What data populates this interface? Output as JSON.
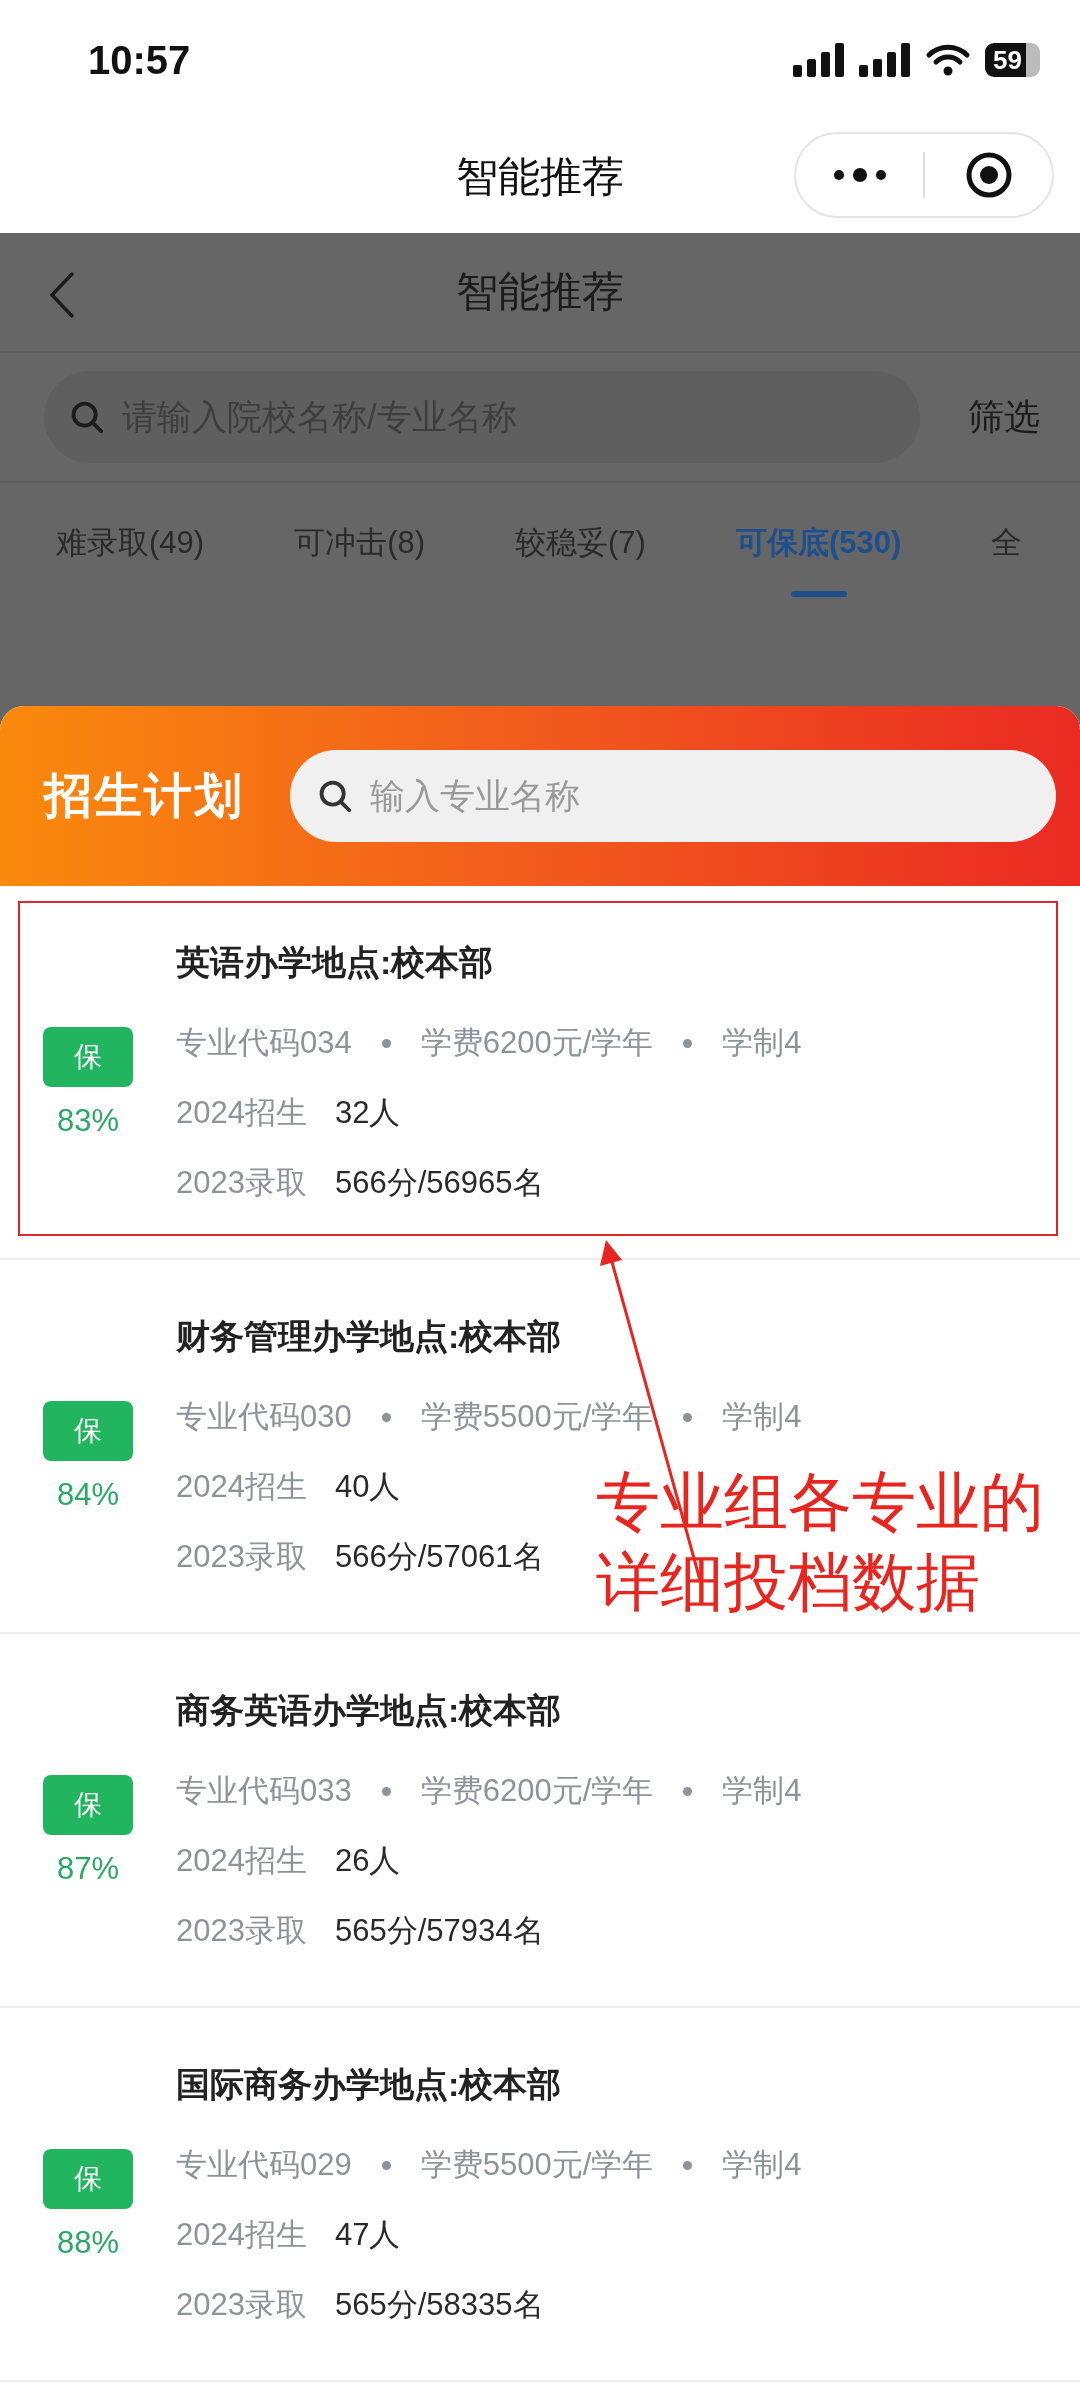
{
  "status_bar": {
    "time": "10:57",
    "battery": "59"
  },
  "mini_program_bar": {
    "title": "智能推荐"
  },
  "page": {
    "title": "智能推荐",
    "search": {
      "placeholder": "请输入院校名称/专业名称"
    },
    "filter": "筛选",
    "tabs": [
      {
        "label": "难录取(49)",
        "selected": false
      },
      {
        "label": "可冲击(8)",
        "selected": false
      },
      {
        "label": "较稳妥(7)",
        "selected": false
      },
      {
        "label": "可保底(530)",
        "selected": true
      },
      {
        "label": "全",
        "selected": false
      }
    ]
  },
  "sheet": {
    "title": "招生计划",
    "search": {
      "placeholder": "输入专业名称"
    },
    "plans": [
      {
        "name": "英语办学地点:校本部",
        "code": "专业代码034",
        "fee": "学费6200元/学年",
        "years": "学制4",
        "enrol_label": "2024招生",
        "enrol": "32人",
        "admit_label": "2023录取",
        "admit": "566分/56965名",
        "badge": "保",
        "chance": "83%",
        "highlighted": true
      },
      {
        "name": "财务管理办学地点:校本部",
        "code": "专业代码030",
        "fee": "学费5500元/学年",
        "years": "学制4",
        "enrol_label": "2024招生",
        "enrol": "40人",
        "admit_label": "2023录取",
        "admit": "566分/57061名",
        "badge": "保",
        "chance": "84%",
        "highlighted": false
      },
      {
        "name": "商务英语办学地点:校本部",
        "code": "专业代码033",
        "fee": "学费6200元/学年",
        "years": "学制4",
        "enrol_label": "2024招生",
        "enrol": "26人",
        "admit_label": "2023录取",
        "admit": "565分/57934名",
        "badge": "保",
        "chance": "87%",
        "highlighted": false
      },
      {
        "name": "国际商务办学地点:校本部",
        "code": "专业代码029",
        "fee": "学费5500元/学年",
        "years": "学制4",
        "enrol_label": "2024招生",
        "enrol": "47人",
        "admit_label": "2023录取",
        "admit": "565分/58335名",
        "badge": "保",
        "chance": "88%",
        "highlighted": false
      }
    ]
  },
  "annotation": {
    "text": "专业组各专业的详细投档数据"
  }
}
